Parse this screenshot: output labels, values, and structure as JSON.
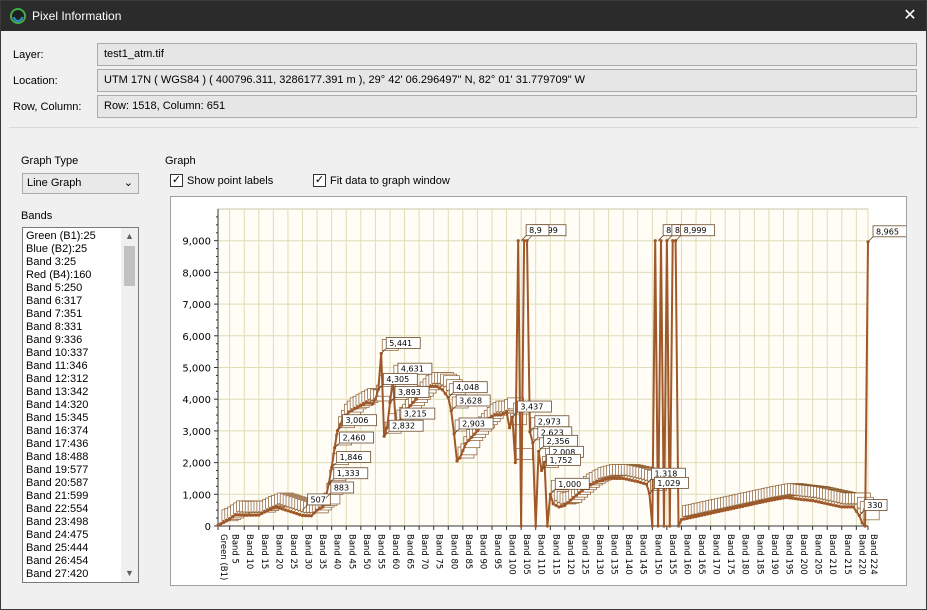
{
  "window": {
    "title": "Pixel Information",
    "close_icon": "close-icon",
    "app_icon": "app-logo-icon"
  },
  "info": {
    "layer_label": "Layer:",
    "layer_value": "test1_atm.tif",
    "location_label": "Location:",
    "location_value": "UTM 17N ( WGS84 ) ( 400796.311, 3286177.391 m ), 29° 42' 06.296497\" N, 82° 01' 31.779709\" W",
    "rowcol_label": "Row, Column:",
    "rowcol_value": "Row: 1518, Column: 651"
  },
  "graph_type": {
    "label": "Graph Type",
    "selected": "Line Graph"
  },
  "bands": {
    "label": "Bands",
    "items": [
      "Green (B1):25",
      "Blue (B2):25",
      "Band 3:25",
      "Red (B4):160",
      "Band 5:250",
      "Band 6:317",
      "Band 7:351",
      "Band 8:331",
      "Band 9:336",
      "Band 10:337",
      "Band 11:346",
      "Band 12:312",
      "Band 13:342",
      "Band 14:320",
      "Band 15:345",
      "Band 16:374",
      "Band 17:436",
      "Band 18:488",
      "Band 19:577",
      "Band 20:587",
      "Band 21:599",
      "Band 22:554",
      "Band 23:498",
      "Band 24:475",
      "Band 25:444",
      "Band 26:454",
      "Band 27:420"
    ]
  },
  "graph": {
    "label": "Graph",
    "show_point_labels": "Show point labels",
    "show_point_labels_checked": true,
    "fit_data": "Fit data to graph window",
    "fit_data_checked": true
  },
  "chart_data": {
    "type": "line",
    "ylim": [
      0,
      10000
    ],
    "yticks": [
      0,
      1000,
      2000,
      3000,
      4000,
      5000,
      6000,
      7000,
      8000,
      9000
    ],
    "ytick_labels": [
      "0",
      "1,000",
      "2,000",
      "3,000",
      "4,000",
      "5,000",
      "6,000",
      "7,000",
      "8,000",
      "9,000"
    ],
    "xtick_labels": [
      "Green (B1)",
      "Band 5",
      "Band 10",
      "Band 15",
      "Band 20",
      "Band 25",
      "Band 30",
      "Band 35",
      "Band 40",
      "Band 45",
      "Band 50",
      "Band 55",
      "Band 60",
      "Band 65",
      "Band 70",
      "Band 75",
      "Band 80",
      "Band 85",
      "Band 90",
      "Band 95",
      "Band 100",
      "Band 105",
      "Band 110",
      "Band 115",
      "Band 120",
      "Band 125",
      "Band 130",
      "Band 135",
      "Band 140",
      "Band 145",
      "Band 150",
      "Band 155",
      "Band 160",
      "Band 165",
      "Band 170",
      "Band 175",
      "Band 180",
      "Band 185",
      "Band 190",
      "Band 195",
      "Band 200",
      "Band 205",
      "Band 210",
      "Band 215",
      "Band 220",
      "Band 224"
    ],
    "xtick_bands": [
      1,
      5,
      10,
      15,
      20,
      25,
      30,
      35,
      40,
      45,
      50,
      55,
      60,
      65,
      70,
      75,
      80,
      85,
      90,
      95,
      100,
      105,
      110,
      115,
      120,
      125,
      130,
      135,
      140,
      145,
      150,
      155,
      160,
      165,
      170,
      175,
      180,
      185,
      190,
      195,
      200,
      205,
      210,
      215,
      220,
      224
    ],
    "grid": true,
    "series_color": "#a0582a",
    "anchors": [
      [
        1,
        25
      ],
      [
        4,
        160
      ],
      [
        7,
        351
      ],
      [
        10,
        337
      ],
      [
        15,
        345
      ],
      [
        18,
        488
      ],
      [
        21,
        599
      ],
      [
        27,
        420
      ],
      [
        30,
        330
      ],
      [
        33,
        320
      ],
      [
        35,
        500
      ],
      [
        37,
        600
      ],
      [
        38,
        900
      ],
      [
        39,
        1333
      ],
      [
        40,
        1846
      ],
      [
        41,
        2460
      ],
      [
        42,
        3006
      ],
      [
        44,
        3400
      ],
      [
        46,
        3600
      ],
      [
        48,
        3700
      ],
      [
        50,
        3800
      ],
      [
        52,
        3900
      ],
      [
        54,
        3850
      ],
      [
        55,
        4000
      ],
      [
        56,
        4305
      ],
      [
        57,
        5441
      ],
      [
        58,
        2832
      ],
      [
        59,
        3100
      ],
      [
        60,
        3893
      ],
      [
        61,
        4631
      ],
      [
        62,
        3215
      ],
      [
        64,
        3400
      ],
      [
        66,
        3700
      ],
      [
        68,
        3900
      ],
      [
        70,
        4100
      ],
      [
        72,
        4300
      ],
      [
        74,
        4400
      ],
      [
        76,
        4400
      ],
      [
        78,
        4300
      ],
      [
        80,
        4048
      ],
      [
        81,
        3628
      ],
      [
        82,
        2903
      ],
      [
        83,
        2050
      ],
      [
        84,
        2150
      ],
      [
        86,
        2600
      ],
      [
        88,
        2800
      ],
      [
        90,
        3000
      ],
      [
        92,
        3200
      ],
      [
        94,
        3400
      ],
      [
        96,
        3500
      ],
      [
        98,
        3500
      ],
      [
        100,
        3600
      ],
      [
        101,
        3100
      ],
      [
        102,
        3437
      ],
      [
        103,
        2000
      ],
      [
        104,
        9000
      ],
      [
        105,
        0
      ],
      [
        106,
        9000
      ],
      [
        107,
        8999
      ],
      [
        108,
        2973
      ],
      [
        109,
        2623
      ],
      [
        110,
        0
      ],
      [
        111,
        2356
      ],
      [
        112,
        1752
      ],
      [
        113,
        2008
      ],
      [
        114,
        0
      ],
      [
        115,
        1000
      ],
      [
        116,
        700
      ],
      [
        118,
        600
      ],
      [
        120,
        650
      ],
      [
        123,
        900
      ],
      [
        127,
        1200
      ],
      [
        131,
        1400
      ],
      [
        135,
        1500
      ],
      [
        140,
        1500
      ],
      [
        145,
        1400
      ],
      [
        148,
        1318
      ],
      [
        149,
        1029
      ],
      [
        150,
        0
      ],
      [
        151,
        9000
      ],
      [
        152,
        0
      ],
      [
        153,
        9000
      ],
      [
        154,
        0
      ],
      [
        155,
        9000
      ],
      [
        156,
        0
      ],
      [
        157,
        9000
      ],
      [
        158,
        8999
      ],
      [
        159,
        0
      ],
      [
        160,
        200
      ],
      [
        165,
        300
      ],
      [
        170,
        400
      ],
      [
        180,
        600
      ],
      [
        190,
        800
      ],
      [
        196,
        900
      ],
      [
        200,
        850
      ],
      [
        205,
        800
      ],
      [
        210,
        700
      ],
      [
        215,
        600
      ],
      [
        219,
        600
      ],
      [
        221,
        330
      ],
      [
        222,
        100
      ],
      [
        223,
        0
      ],
      [
        224,
        8965
      ]
    ],
    "point_labels": [
      {
        "band": 30,
        "value": 507,
        "text": "507"
      },
      {
        "band": 39,
        "value": 1333,
        "text": "1,333"
      },
      {
        "band": 40,
        "value": 1846,
        "text": "1,846"
      },
      {
        "band": 41,
        "value": 2460,
        "text": "2,460"
      },
      {
        "band": 42,
        "value": 3006,
        "text": "3,006"
      },
      {
        "band": 38,
        "value": 883,
        "text": "883"
      },
      {
        "band": 57,
        "value": 5441,
        "text": "5,441"
      },
      {
        "band": 61,
        "value": 4631,
        "text": "4,631"
      },
      {
        "band": 56,
        "value": 4305,
        "text": "4,305"
      },
      {
        "band": 60,
        "value": 3893,
        "text": "3,893"
      },
      {
        "band": 62,
        "value": 3215,
        "text": "3,215"
      },
      {
        "band": 58,
        "value": 2832,
        "text": "2,832"
      },
      {
        "band": 80,
        "value": 4048,
        "text": "4,048"
      },
      {
        "band": 81,
        "value": 3628,
        "text": "3,628"
      },
      {
        "band": 82,
        "value": 2903,
        "text": "2,903"
      },
      {
        "band": 102,
        "value": 3437,
        "text": "3,437"
      },
      {
        "band": 108,
        "value": 2973,
        "text": "2,973"
      },
      {
        "band": 109,
        "value": 2623,
        "text": "2,623"
      },
      {
        "band": 111,
        "value": 2356,
        "text": "2,356"
      },
      {
        "band": 113,
        "value": 2008,
        "text": "2,008"
      },
      {
        "band": 112,
        "value": 1752,
        "text": "1,752"
      },
      {
        "band": 115,
        "value": 1000,
        "text": "1,000"
      },
      {
        "band": 107,
        "value": 8999,
        "text": "8,999"
      },
      {
        "band": 105,
        "value": 9000,
        "text": "8,9"
      },
      {
        "band": 148,
        "value": 1318,
        "text": "1,318"
      },
      {
        "band": 149,
        "value": 1029,
        "text": "1,029"
      },
      {
        "band": 152,
        "value": 9000,
        "text": "8,"
      },
      {
        "band": 155,
        "value": 9000,
        "text": "8,9"
      },
      {
        "band": 158,
        "value": 8999,
        "text": "8,999"
      },
      {
        "band": 224,
        "value": 8965,
        "text": "8,965"
      },
      {
        "band": 221,
        "value": 330,
        "text": "330"
      }
    ]
  }
}
